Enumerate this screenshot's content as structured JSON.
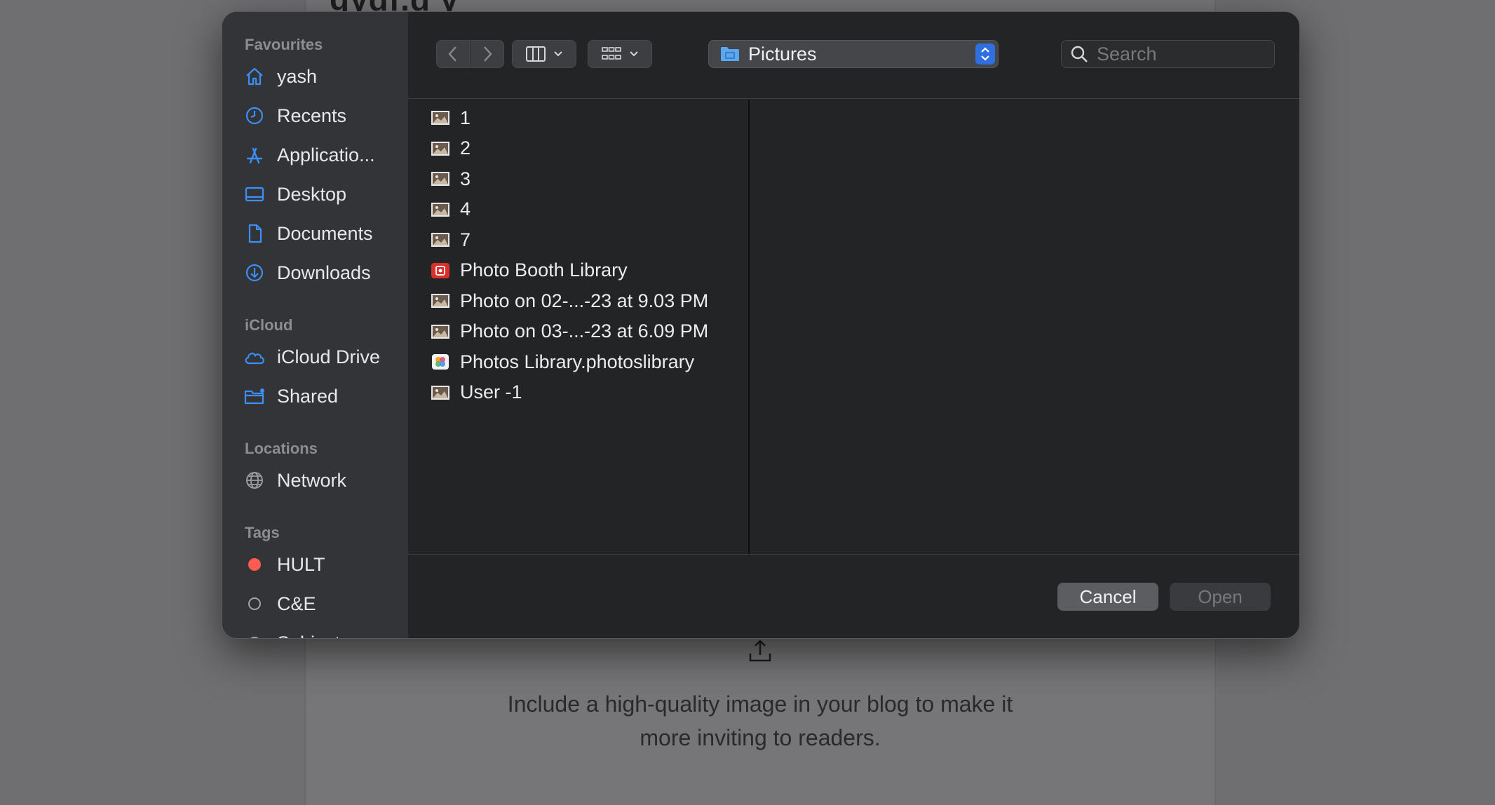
{
  "background": {
    "title": "gydf.d y",
    "upload_hint": "Include a high-quality image in your blog to make it more inviting to readers."
  },
  "sidebar": {
    "sections": [
      {
        "title": "Favourites",
        "items": [
          {
            "label": "yash",
            "icon": "home-icon"
          },
          {
            "label": "Recents",
            "icon": "clock-icon"
          },
          {
            "label": "Applicatio...",
            "icon": "applications-icon"
          },
          {
            "label": "Desktop",
            "icon": "desktop-icon"
          },
          {
            "label": "Documents",
            "icon": "document-icon"
          },
          {
            "label": "Downloads",
            "icon": "download-icon"
          }
        ]
      },
      {
        "title": "iCloud",
        "items": [
          {
            "label": "iCloud Drive",
            "icon": "cloud-icon"
          },
          {
            "label": "Shared",
            "icon": "shared-folder-icon"
          }
        ]
      },
      {
        "title": "Locations",
        "items": [
          {
            "label": "Network",
            "icon": "globe-icon"
          }
        ]
      },
      {
        "title": "Tags",
        "items": [
          {
            "label": "HULT",
            "icon": "tag-red-icon",
            "color": "#ff5b50"
          },
          {
            "label": "C&E",
            "icon": "tag-empty-icon"
          },
          {
            "label": "Subjects",
            "icon": "tag-empty-icon"
          }
        ]
      }
    ]
  },
  "toolbar": {
    "location": "Pictures",
    "search_placeholder": "Search"
  },
  "files": [
    {
      "name": "1",
      "kind": "image"
    },
    {
      "name": "2",
      "kind": "image"
    },
    {
      "name": "3",
      "kind": "image"
    },
    {
      "name": "4",
      "kind": "image"
    },
    {
      "name": "7",
      "kind": "image"
    },
    {
      "name": "Photo Booth Library",
      "kind": "photobooth"
    },
    {
      "name": "Photo on 02-...-23 at 9.03 PM",
      "kind": "image"
    },
    {
      "name": "Photo on 03-...-23 at 6.09 PM",
      "kind": "image"
    },
    {
      "name": "Photos Library.photoslibrary",
      "kind": "photoslibrary"
    },
    {
      "name": "User -1",
      "kind": "image"
    }
  ],
  "footer": {
    "cancel_label": "Cancel",
    "open_label": "Open"
  },
  "colors": {
    "accent": "#2f6fe0",
    "sidebar_icon": "#3d8ef7",
    "tag_red": "#ff5b50"
  }
}
